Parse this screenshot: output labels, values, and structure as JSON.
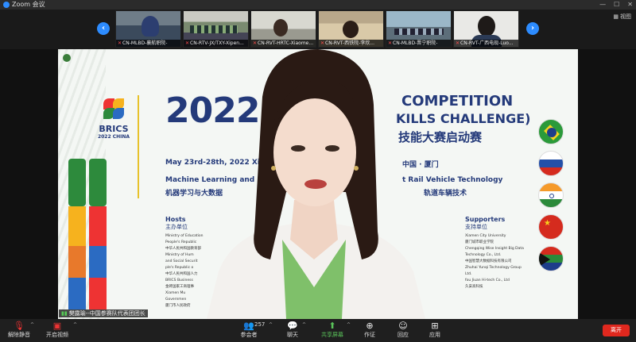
{
  "window": {
    "app_name": "Zoom 会议"
  },
  "gallery": {
    "view_label": "视图",
    "tiles": [
      {
        "name": "CN-MLBD-襄航职院-"
      },
      {
        "name": "CN-RTV-JX/TXY-Xipen..."
      },
      {
        "name": "CN-RVT-HRTC-Xiaome..."
      },
      {
        "name": "CN-RVT-西铁院-李欣..."
      },
      {
        "name": "CN-MLBD-晋宁职院-"
      },
      {
        "name": "CN-RVT-广西电现-Luo..."
      }
    ]
  },
  "slide": {
    "logo_name": "BRICS",
    "logo_sub": "2022 CHINA",
    "year": "2022",
    "comp_line1": "COMPETITION",
    "comp_line2": "KILLS CHALLENGE)",
    "comp_line3": "技能大赛启动赛",
    "dates": "May 23rd-28th, 2022    Xia",
    "city": "中国 · 厦门",
    "track1_en": "Machine Learning and Bi",
    "track1_cn": "机器学习与大数据",
    "track2_en": "t       Rail Vehicle Technology",
    "track2_cn": "轨道车辆技术",
    "hosts_title": "Hosts",
    "hosts_title_cn": "主办单位",
    "hosts_items": [
      "Ministry of Education",
      "People's Republic",
      "中华人民共和国教育部",
      "Ministry of Hum",
      "and Social Securit",
      "ple's Republic o",
      "中华人民共和国人力",
      "BRICS Business",
      "金砖国家工商理事",
      "Xiamen Mu",
      "Governmen",
      "厦门市人民政府"
    ],
    "supporters_title": "Supporters",
    "supporters_title_cn": "支持单位",
    "supporters_items": [
      "Xiamen City University",
      "厦门城市职业学院",
      "Chengqing Wise Insight Big Data",
      "Technology Co., Ltd.",
      "中国智慧大数据科技有限公司",
      "Zhuhai Yunqi Technology Group",
      "Ltd.",
      "fou Jiuan Hi-tech Co., Ltd",
      "久安高科技"
    ]
  },
  "speaker": {
    "name": "樊露瑜--中国参赛队代表团团长"
  },
  "toolbar": {
    "mute_label": "解除静音",
    "video_label": "开启视频",
    "participants_label": "参会者",
    "participants_count": "257",
    "chat_label": "聊天",
    "share_label": "共享屏幕",
    "reactions_label": "作证",
    "record_label": "回应",
    "apps_label": "应用",
    "leave_label": "离开"
  },
  "colors": {
    "accent": "#2d8cff",
    "leave": "#e0281e",
    "share": "#5ac35a",
    "slide_navy": "#243a7a"
  }
}
